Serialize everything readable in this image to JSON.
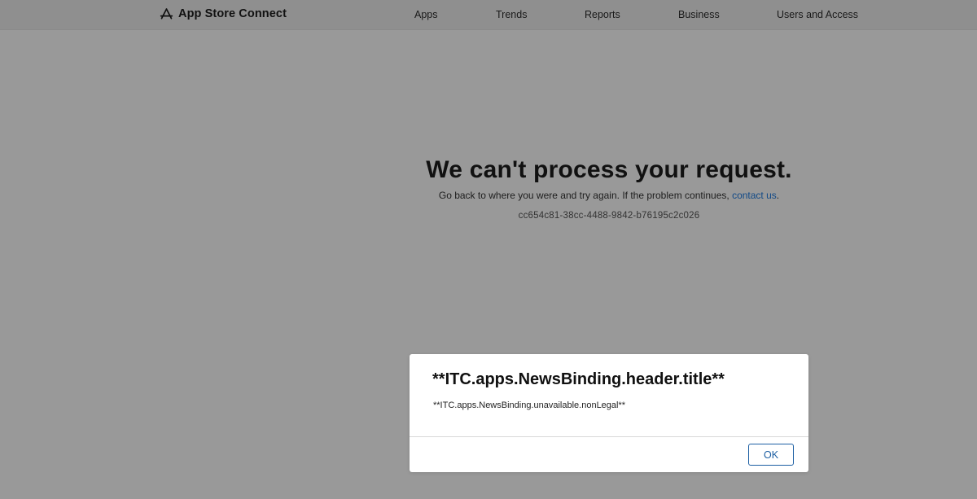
{
  "header": {
    "brand_icon": "app-store-icon",
    "brand_label": "App Store Connect",
    "nav": {
      "apps": "Apps",
      "trends": "Trends",
      "reports": "Reports",
      "business": "Business",
      "users": "Users and Access"
    }
  },
  "error": {
    "title": "We can't process your request.",
    "message": "Go back to where you were and try again. If the problem continues,",
    "link_text": "contact us",
    "message_end": ".",
    "request_id": "cc654c81-38cc-4488-9842-b76195c2c026"
  },
  "dialog": {
    "title": "**ITC.apps.NewsBinding.header.title**",
    "body": "**ITC.apps.NewsBinding.unavailable.nonLegal**",
    "ok_label": "OK"
  },
  "colors": {
    "backdrop": "#999999",
    "link": "#124a87",
    "button_accent": "#1d5fa3"
  }
}
